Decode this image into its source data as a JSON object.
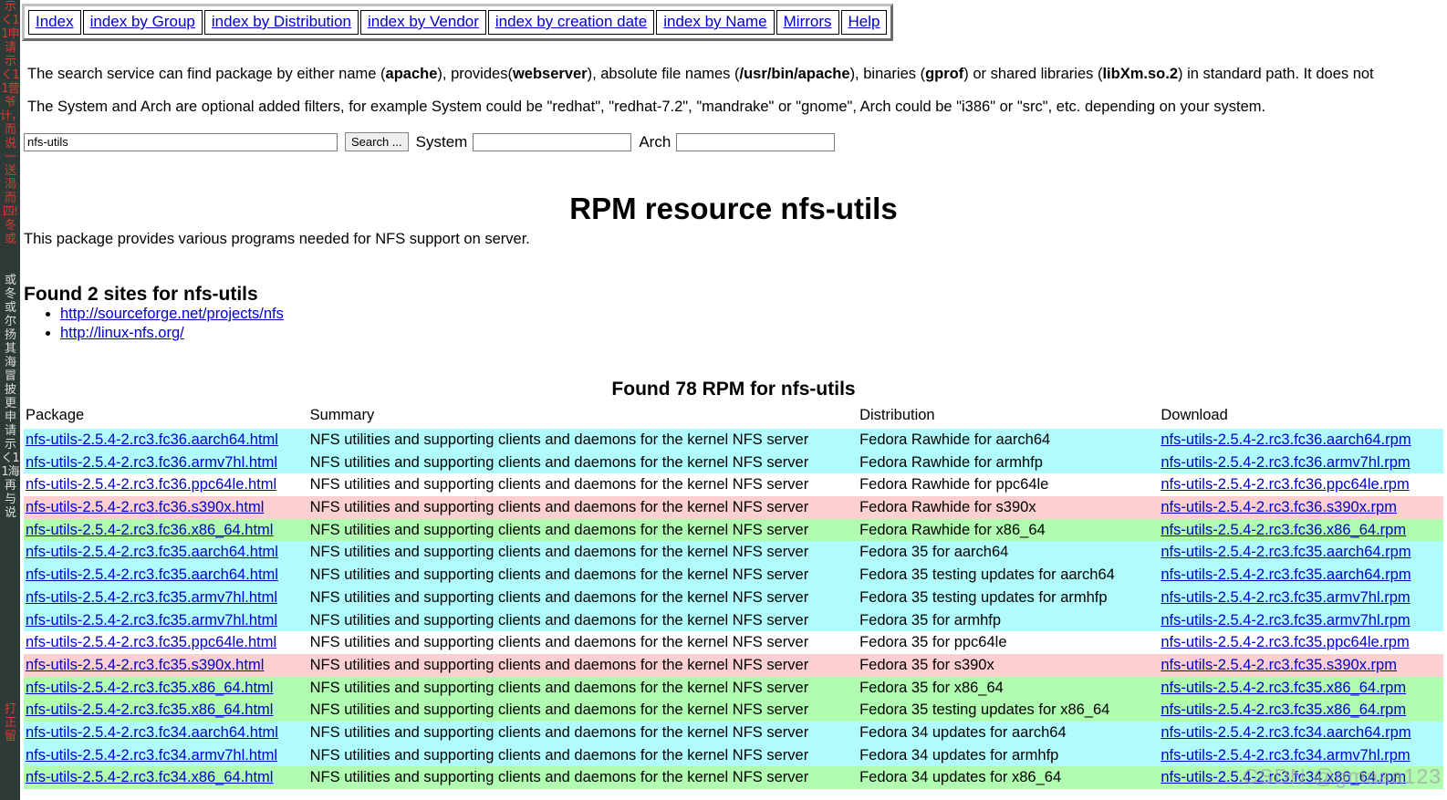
{
  "left_strip": {
    "glyph_text_top": "示く11申请示く11营爷计，而说一送渴而四!冬或",
    "glyph_text_mid": "或冬或尔扬其海冒披更申请示く11海再与说",
    "glyph_text_bottom": "打正留"
  },
  "nav": {
    "items": [
      {
        "label": "Index"
      },
      {
        "label": "index by Group"
      },
      {
        "label": "index by Distribution"
      },
      {
        "label": "index by Vendor"
      },
      {
        "label": "index by creation date"
      },
      {
        "label": "index by Name"
      },
      {
        "label": "Mirrors"
      },
      {
        "label": "Help"
      }
    ]
  },
  "intro": {
    "paragraph1": "The search service can find package by either name (apache), provides(webserver), absolute file names (/usr/bin/apache), binaries (gprof) or shared libraries (libXm.so.2) in standard path. It does not",
    "paragraph1_parts": [
      {
        "text": "The search service can find package by either name (",
        "bold": false
      },
      {
        "text": "apache",
        "bold": true
      },
      {
        "text": "), provides(",
        "bold": false
      },
      {
        "text": "webserver",
        "bold": true
      },
      {
        "text": "), absolute file names (",
        "bold": false
      },
      {
        "text": "/usr/bin/apache",
        "bold": true
      },
      {
        "text": "), binaries (",
        "bold": false
      },
      {
        "text": "gprof",
        "bold": true
      },
      {
        "text": ") or shared libraries (",
        "bold": false
      },
      {
        "text": "libXm.so.2",
        "bold": true
      },
      {
        "text": ") in standard path. It does not",
        "bold": false
      }
    ],
    "paragraph2": "The System and Arch are optional added filters, for example System could be \"redhat\", \"redhat-7.2\", \"mandrake\" or \"gnome\", Arch could be \"i386\" or \"src\", etc. depending on your system."
  },
  "search_form": {
    "query_value": "nfs-utils",
    "query_placeholder": "",
    "search_button_label": "Search ...",
    "system_label": "System",
    "system_value": "",
    "system_placeholder": "",
    "arch_label": "Arch",
    "arch_value": "",
    "arch_placeholder": ""
  },
  "page": {
    "title": "RPM resource nfs-utils",
    "description": "This package provides various programs needed for NFS support on server.",
    "sites_heading": "Found 2 sites for nfs-utils",
    "sites": [
      "http://sourceforge.net/projects/nfs",
      "http://linux-nfs.org/"
    ],
    "rpm_heading": "Found 78 RPM for nfs-utils"
  },
  "table": {
    "columns": [
      "Package",
      "Summary",
      "Distribution",
      "Download"
    ],
    "summary_text": "NFS utilities and supporting clients and daemons for the kernel NFS server",
    "rows": [
      {
        "package": "nfs-utils-2.5.4-2.rc3.fc36.aarch64.html",
        "summary": "NFS utilities and supporting clients and daemons for the kernel NFS server",
        "distribution": "Fedora Rawhide for aarch64",
        "download": "nfs-utils-2.5.4-2.rc3.fc36.aarch64.rpm",
        "color": "cyan"
      },
      {
        "package": "nfs-utils-2.5.4-2.rc3.fc36.armv7hl.html",
        "summary": "NFS utilities and supporting clients and daemons for the kernel NFS server",
        "distribution": "Fedora Rawhide for armhfp",
        "download": "nfs-utils-2.5.4-2.rc3.fc36.armv7hl.rpm",
        "color": "cyan"
      },
      {
        "package": "nfs-utils-2.5.4-2.rc3.fc36.ppc64le.html",
        "summary": "NFS utilities and supporting clients and daemons for the kernel NFS server",
        "distribution": "Fedora Rawhide for ppc64le",
        "download": "nfs-utils-2.5.4-2.rc3.fc36.ppc64le.rpm",
        "color": "white"
      },
      {
        "package": "nfs-utils-2.5.4-2.rc3.fc36.s390x.html",
        "summary": "NFS utilities and supporting clients and daemons for the kernel NFS server",
        "distribution": "Fedora Rawhide for s390x",
        "download": "nfs-utils-2.5.4-2.rc3.fc36.s390x.rpm",
        "color": "pink"
      },
      {
        "package": "nfs-utils-2.5.4-2.rc3.fc36.x86_64.html",
        "summary": "NFS utilities and supporting clients and daemons for the kernel NFS server",
        "distribution": "Fedora Rawhide for x86_64",
        "download": "nfs-utils-2.5.4-2.rc3.fc36.x86_64.rpm",
        "color": "green"
      },
      {
        "package": "nfs-utils-2.5.4-2.rc3.fc35.aarch64.html",
        "summary": "NFS utilities and supporting clients and daemons for the kernel NFS server",
        "distribution": "Fedora 35 for aarch64",
        "download": "nfs-utils-2.5.4-2.rc3.fc35.aarch64.rpm",
        "color": "cyan"
      },
      {
        "package": "nfs-utils-2.5.4-2.rc3.fc35.aarch64.html",
        "summary": "NFS utilities and supporting clients and daemons for the kernel NFS server",
        "distribution": "Fedora 35 testing updates for aarch64",
        "download": "nfs-utils-2.5.4-2.rc3.fc35.aarch64.rpm",
        "color": "cyan"
      },
      {
        "package": "nfs-utils-2.5.4-2.rc3.fc35.armv7hl.html",
        "summary": "NFS utilities and supporting clients and daemons for the kernel NFS server",
        "distribution": "Fedora 35 testing updates for armhfp",
        "download": "nfs-utils-2.5.4-2.rc3.fc35.armv7hl.rpm",
        "color": "cyan"
      },
      {
        "package": "nfs-utils-2.5.4-2.rc3.fc35.armv7hl.html",
        "summary": "NFS utilities and supporting clients and daemons for the kernel NFS server",
        "distribution": "Fedora 35 for armhfp",
        "download": "nfs-utils-2.5.4-2.rc3.fc35.armv7hl.rpm",
        "color": "cyan"
      },
      {
        "package": "nfs-utils-2.5.4-2.rc3.fc35.ppc64le.html",
        "summary": "NFS utilities and supporting clients and daemons for the kernel NFS server",
        "distribution": "Fedora 35 for ppc64le",
        "download": "nfs-utils-2.5.4-2.rc3.fc35.ppc64le.rpm",
        "color": "white"
      },
      {
        "package": "nfs-utils-2.5.4-2.rc3.fc35.s390x.html",
        "summary": "NFS utilities and supporting clients and daemons for the kernel NFS server",
        "distribution": "Fedora 35 for s390x",
        "download": "nfs-utils-2.5.4-2.rc3.fc35.s390x.rpm",
        "color": "pink"
      },
      {
        "package": "nfs-utils-2.5.4-2.rc3.fc35.x86_64.html",
        "summary": "NFS utilities and supporting clients and daemons for the kernel NFS server",
        "distribution": "Fedora 35 for x86_64",
        "download": "nfs-utils-2.5.4-2.rc3.fc35.x86_64.rpm",
        "color": "green"
      },
      {
        "package": "nfs-utils-2.5.4-2.rc3.fc35.x86_64.html",
        "summary": "NFS utilities and supporting clients and daemons for the kernel NFS server",
        "distribution": "Fedora 35 testing updates for x86_64",
        "download": "nfs-utils-2.5.4-2.rc3.fc35.x86_64.rpm",
        "color": "green"
      },
      {
        "package": "nfs-utils-2.5.4-2.rc3.fc34.aarch64.html",
        "summary": "NFS utilities and supporting clients and daemons for the kernel NFS server",
        "distribution": "Fedora 34 updates for aarch64",
        "download": "nfs-utils-2.5.4-2.rc3.fc34.aarch64.rpm",
        "color": "cyan"
      },
      {
        "package": "nfs-utils-2.5.4-2.rc3.fc34.armv7hl.html",
        "summary": "NFS utilities and supporting clients and daemons for the kernel NFS server",
        "distribution": "Fedora 34 updates for armhfp",
        "download": "nfs-utils-2.5.4-2.rc3.fc34.armv7hl.rpm",
        "color": "cyan"
      },
      {
        "package": "nfs-utils-2.5.4-2.rc3.fc34.x86_64.html",
        "summary": "NFS utilities and supporting clients and daemons for the kernel NFS server",
        "distribution": "Fedora 34 updates for x86_64",
        "download": "nfs-utils-2.5.4-2.rc3.fc34.x86_64.rpm",
        "color": "green"
      }
    ]
  },
  "watermark": {
    "text": "CSDN @gmaaa123"
  },
  "colors": {
    "link": "#0000cc",
    "row_cyan": "#b0fcfc",
    "row_pink": "#fcd0d0",
    "row_green": "#b0fcb0",
    "row_white": "#ffffff",
    "page_bg": "#ffffff",
    "strip_bg": "#2d3a38"
  }
}
